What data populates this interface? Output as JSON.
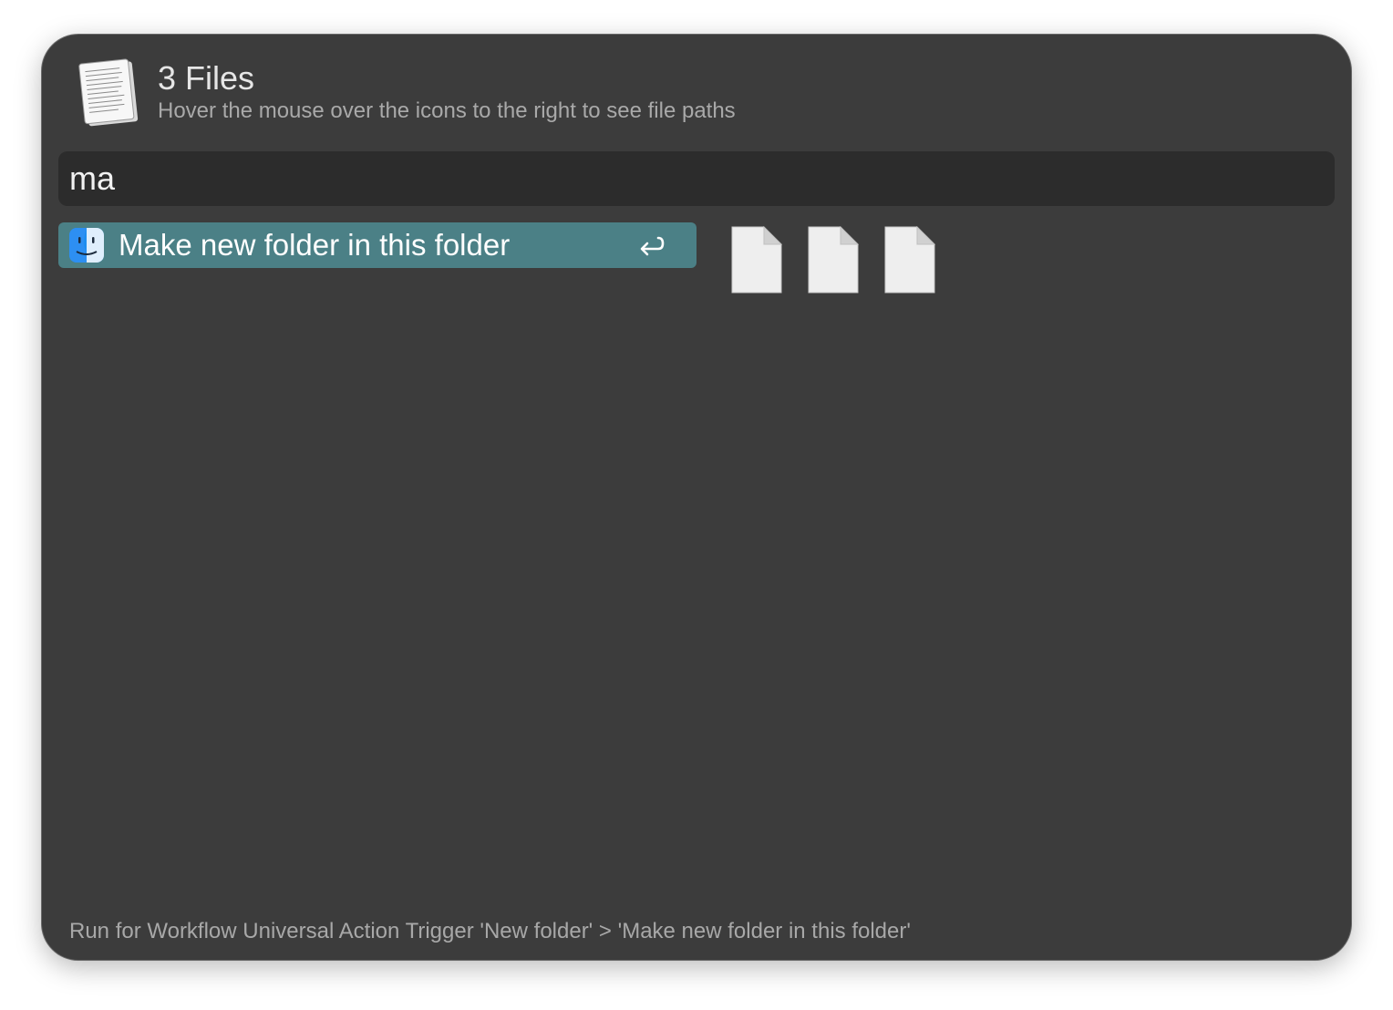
{
  "header": {
    "icon": "document-stack-icon",
    "title": "3 Files",
    "subtitle": "Hover the mouse over the icons to the right to see file paths"
  },
  "search": {
    "value": "ma"
  },
  "results": [
    {
      "icon": "finder-icon",
      "label": "Make new folder in this folder",
      "shortcut": "return-key-icon",
      "selected": true
    }
  ],
  "files": [
    {
      "icon": "file-icon"
    },
    {
      "icon": "file-icon"
    },
    {
      "icon": "file-icon"
    }
  ],
  "footer": {
    "text": "Run for Workflow Universal Action Trigger 'New folder' > 'Make new folder in this folder'"
  },
  "colors": {
    "window_bg": "#3c3c3c",
    "search_bg": "#2c2c2c",
    "selection": "#4b8086"
  }
}
